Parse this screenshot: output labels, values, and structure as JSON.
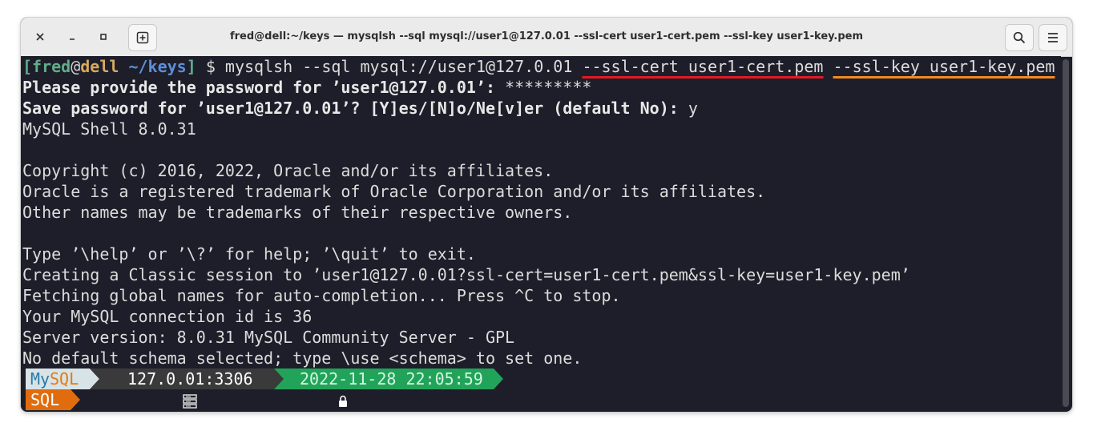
{
  "window": {
    "title": "fred@dell:~/keys — mysqlsh --sql mysql://user1@127.0.01 --ssl-cert user1-cert.pem --ssl-key user1-key.pem"
  },
  "prompt": {
    "open_bracket": "[",
    "user": "fred",
    "at": "@",
    "host": "dell",
    "dir": " ~/keys",
    "close_bracket": "]",
    "symbol": " $ ",
    "command": "mysqlsh --sql mysql://user1@127.0.01 ",
    "ssl_cert_arg": "--ssl-cert user1-cert.pem",
    "ssl_key_arg": "--ssl-key user1-key.pem"
  },
  "output": {
    "pw_prompt": "Please provide the password for ’user1@127.0.01’: ",
    "pw_mask": "*********",
    "save_prompt": "Save password for ’user1@127.0.01’? [Y]es/[N]o/Ne[v]er (default No): ",
    "save_answer": "y",
    "lines": [
      "MySQL Shell 8.0.31",
      "",
      "Copyright (c) 2016, 2022, Oracle and/or its affiliates.",
      "Oracle is a registered trademark of Oracle Corporation and/or its affiliates.",
      "Other names may be trademarks of their respective owners.",
      "",
      "Type ’\\help’ or ’\\?’ for help; ’\\quit’ to exit.",
      "Creating a Classic session to ’user1@127.0.01?ssl-cert=user1-cert.pem&ssl-key=user1-key.pem’",
      "Fetching global names for auto-completion... Press ^C to stop.",
      "Your MySQL connection id is 36",
      "Server version: 8.0.31 MySQL Community Server - GPL",
      "No default schema selected; type \\use <schema> to set one."
    ]
  },
  "status_bar": {
    "logo_my": "My",
    "logo_sql": "SQL",
    "host_port": "127.0.01:3306",
    "timestamp": "2022-11-28 22:05:59",
    "mode": "SQL"
  },
  "colors": {
    "terminal_bg": "#1e1e2a",
    "logo_bg": "#d8e3e8",
    "host_bg": "#3a3a3a",
    "time_bg": "#22a35a",
    "mode_bg": "#e06c0e",
    "cert_underline": "#e01b24",
    "key_underline": "#f08a24"
  }
}
